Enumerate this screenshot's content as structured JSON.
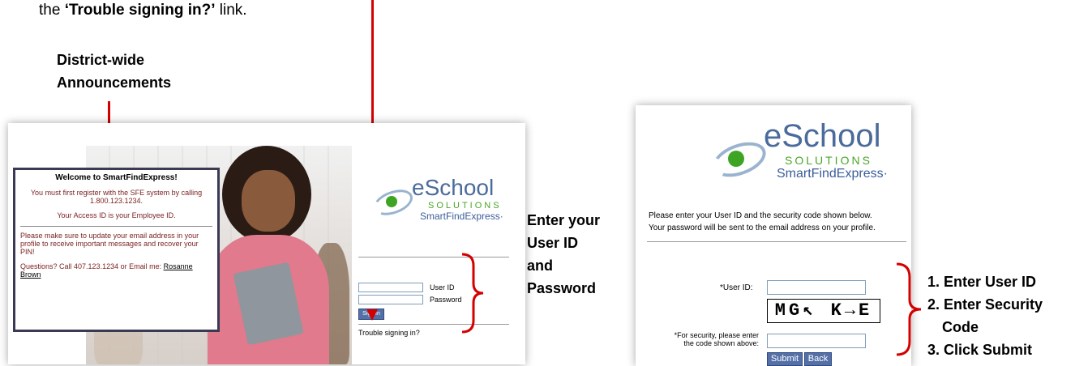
{
  "top_caption": {
    "prefix": "the ",
    "link": "‘Trouble signing in?’",
    "suffix": " link."
  },
  "callouts": {
    "district_line1": "District-wide",
    "district_line2": "Announcements",
    "enter_line1": "Enter your",
    "enter_line2": "User ID",
    "enter_line3": "and",
    "enter_line4": "Password",
    "step1": "1. Enter User ID",
    "step2_line1": "2. Enter Security",
    "step2_line2": "Code",
    "step3": "3. Click Submit"
  },
  "login_panel": {
    "announcement": {
      "title": "Welcome to SmartFindExpress!",
      "line1": "You must first register with the SFE system by calling",
      "line2": "1.800.123.1234.",
      "line3": "Your Access ID is your Employee ID.",
      "line4": "Please make sure to update your email address in your profile to receive important messages and recover your PIN!",
      "line5_prefix": "Questions? Call 407.123.1234 or Email me: ",
      "line5_link": "Rosanne Brown"
    },
    "logo": {
      "e": "eSchool",
      "solutions": "SOLUTIONS",
      "sfe": "SmartFindExpress·"
    },
    "user_id_label": "User ID",
    "password_label": "Password",
    "signin_button": "Sign In",
    "trouble_link": "Trouble signing in?"
  },
  "recovery_panel": {
    "logo": {
      "e": "eSchool",
      "solutions": "SOLUTIONS",
      "sfe": "SmartFindExpress·"
    },
    "instructions_line1": "Please enter your User ID and the security code shown below.",
    "instructions_line2": "Your password will be sent to the email address on your profile.",
    "user_id_label": "*User ID:",
    "captcha_text": "MG↖ K→E",
    "security_label_line1": "*For security, please enter",
    "security_label_line2": "the code shown above:",
    "submit_button": "Submit",
    "back_button": "Back"
  },
  "colors": {
    "arrow": "#d40000",
    "logo_blue": "#4a6b9b",
    "logo_green": "#4aa62a",
    "button_blue": "#5470a6"
  }
}
